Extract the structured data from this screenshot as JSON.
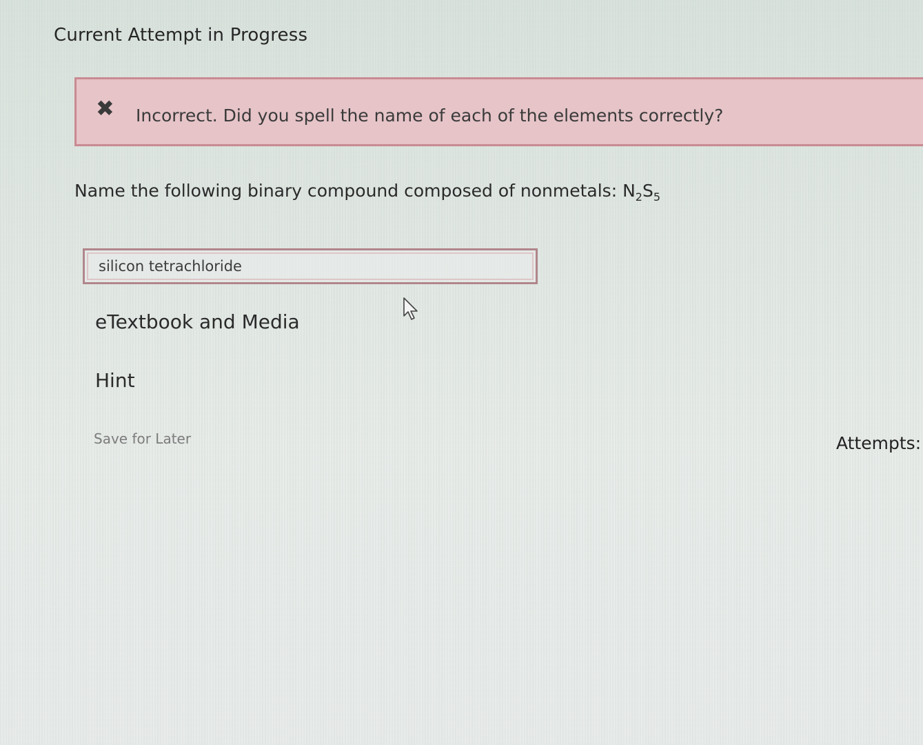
{
  "page": {
    "title": "Current Attempt in Progress"
  },
  "feedback": {
    "status": "incorrect",
    "message": "Incorrect. Did you spell the name of each of the elements correctly?",
    "icon": "close-icon",
    "colors": {
      "background": "#e6c4c8",
      "border": "#c98a92"
    }
  },
  "question": {
    "prompt": "Name the following binary compound composed of nonmetals: ",
    "formula": {
      "el1": "N",
      "sub1": "2",
      "el2": "S",
      "sub2": "5"
    }
  },
  "answer": {
    "value": "silicon tetrachloride"
  },
  "links": {
    "etextbook": "eTextbook and Media",
    "hint": "Hint"
  },
  "actions": {
    "save_later": "Save for Later"
  },
  "attempts": {
    "label": "Attempts:"
  }
}
